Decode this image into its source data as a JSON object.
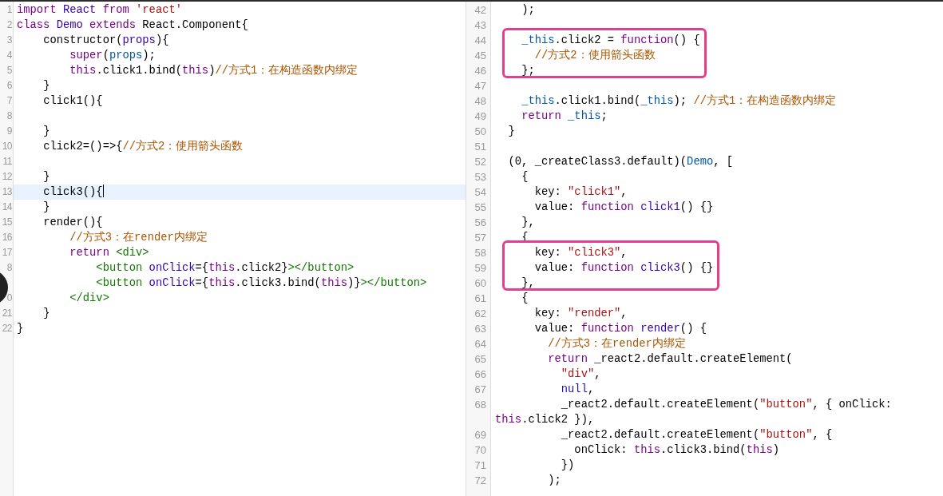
{
  "left_pane": {
    "lines": [
      {
        "number": "1",
        "active": false,
        "tokens": [
          {
            "kind": "keyword",
            "text": "import "
          },
          {
            "kind": "def",
            "text": "React "
          },
          {
            "kind": "keyword",
            "text": "from "
          },
          {
            "kind": "string",
            "text": "'react'"
          }
        ]
      },
      {
        "number": "2",
        "active": false,
        "tokens": [
          {
            "kind": "keyword",
            "text": "class "
          },
          {
            "kind": "def",
            "text": "Demo "
          },
          {
            "kind": "keyword",
            "text": "extends"
          },
          {
            "kind": "plain",
            "text": " React.Component{"
          }
        ]
      },
      {
        "number": "3",
        "active": false,
        "tokens": [
          {
            "kind": "plain",
            "text": "    constructor("
          },
          {
            "kind": "def",
            "text": "props"
          },
          {
            "kind": "plain",
            "text": "){"
          }
        ]
      },
      {
        "number": "4",
        "active": false,
        "tokens": [
          {
            "kind": "keyword",
            "text": "        super"
          },
          {
            "kind": "plain",
            "text": "("
          },
          {
            "kind": "var",
            "text": "props"
          },
          {
            "kind": "plain",
            "text": ");"
          }
        ]
      },
      {
        "number": "5",
        "active": false,
        "tokens": [
          {
            "kind": "keyword",
            "text": "        this"
          },
          {
            "kind": "plain",
            "text": ".click1.bind("
          },
          {
            "kind": "keyword",
            "text": "this"
          },
          {
            "kind": "plain",
            "text": ")"
          },
          {
            "kind": "comment",
            "text": "//方式1：在构造函数内绑定"
          }
        ]
      },
      {
        "number": "6",
        "active": false,
        "tokens": [
          {
            "kind": "plain",
            "text": "    }"
          }
        ]
      },
      {
        "number": "7",
        "active": false,
        "tokens": [
          {
            "kind": "plain",
            "text": "    click1(){"
          }
        ]
      },
      {
        "number": "8",
        "active": false
      },
      {
        "number": "9",
        "active": false,
        "tokens": [
          {
            "kind": "plain",
            "text": "    }"
          }
        ]
      },
      {
        "number": "10",
        "active": false,
        "tokens": [
          {
            "kind": "plain",
            "text": "    click2=()=>{"
          },
          {
            "kind": "comment",
            "text": "//方式2：使用箭头函数"
          }
        ]
      },
      {
        "number": "11",
        "active": false
      },
      {
        "number": "12",
        "active": false,
        "tokens": [
          {
            "kind": "plain",
            "text": "    }"
          }
        ]
      },
      {
        "number": "13",
        "active": true,
        "tokens": [
          {
            "kind": "plain",
            "text": "    click3(){"
          }
        ]
      },
      {
        "number": "14",
        "active": false,
        "tokens": [
          {
            "kind": "plain",
            "text": "    }"
          }
        ]
      },
      {
        "number": "15",
        "active": false,
        "tokens": [
          {
            "kind": "plain",
            "text": "    render(){"
          }
        ]
      },
      {
        "number": "16",
        "active": false,
        "tokens": [
          {
            "kind": "comment",
            "text": "        //方式3：在render内绑定"
          }
        ]
      },
      {
        "number": "17",
        "active": false,
        "tokens": [
          {
            "kind": "keyword",
            "text": "        return "
          },
          {
            "kind": "tag",
            "text": "<div>"
          }
        ]
      },
      {
        "number": "8",
        "active": false,
        "tokens": [
          {
            "kind": "tag",
            "text": "            <button "
          },
          {
            "kind": "attr",
            "text": "onClick"
          },
          {
            "kind": "plain",
            "text": "={"
          },
          {
            "kind": "keyword",
            "text": "this"
          },
          {
            "kind": "plain",
            "text": ".click2}"
          },
          {
            "kind": "tag",
            "text": "></button>"
          }
        ]
      },
      {
        "active": false,
        "tokens": [
          {
            "kind": "tag",
            "text": "            <button "
          },
          {
            "kind": "attr",
            "text": "onClick"
          },
          {
            "kind": "plain",
            "text": "={"
          },
          {
            "kind": "keyword",
            "text": "this"
          },
          {
            "kind": "plain",
            "text": ".click3.bind("
          },
          {
            "kind": "keyword",
            "text": "this"
          },
          {
            "kind": "plain",
            "text": ")}"
          },
          {
            "kind": "tag",
            "text": "></button>"
          }
        ]
      },
      {
        "number": "0",
        "active": false,
        "tokens": [
          {
            "kind": "tag",
            "text": "        </div>"
          }
        ]
      },
      {
        "number": "21",
        "active": false,
        "tokens": [
          {
            "kind": "plain",
            "text": "    }"
          }
        ]
      },
      {
        "number": "22",
        "active": false,
        "tokens": [
          {
            "kind": "plain",
            "text": "}"
          }
        ]
      }
    ]
  },
  "right_pane": {
    "lines": [
      {
        "number": "42",
        "boxed": false,
        "tokens": [
          {
            "kind": "plain",
            "text": "    );"
          }
        ]
      },
      {
        "number": "43",
        "boxed": false
      },
      {
        "number": "44",
        "boxed": true,
        "tokens": [
          {
            "kind": "var",
            "text": "    _this"
          },
          {
            "kind": "plain",
            "text": ".click2 = "
          },
          {
            "kind": "keyword",
            "text": "function"
          },
          {
            "kind": "plain",
            "text": "() {"
          }
        ]
      },
      {
        "number": "45",
        "boxed": true,
        "tokens": [
          {
            "kind": "comment",
            "text": "      //方式2：使用箭头函数"
          }
        ]
      },
      {
        "number": "46",
        "boxed": true,
        "tokens": [
          {
            "kind": "plain",
            "text": "    };"
          }
        ]
      },
      {
        "number": "47",
        "boxed": false
      },
      {
        "number": "48",
        "boxed": false,
        "tokens": [
          {
            "kind": "var",
            "text": "    _this"
          },
          {
            "kind": "plain",
            "text": ".click1.bind("
          },
          {
            "kind": "var",
            "text": "_this"
          },
          {
            "kind": "plain",
            "text": "); "
          },
          {
            "kind": "comment",
            "text": "//方式1：在构造函数内绑定"
          }
        ]
      },
      {
        "number": "49",
        "boxed": false,
        "tokens": [
          {
            "kind": "keyword",
            "text": "    return "
          },
          {
            "kind": "var",
            "text": "_this"
          },
          {
            "kind": "plain",
            "text": ";"
          }
        ]
      },
      {
        "number": "50",
        "boxed": false,
        "tokens": [
          {
            "kind": "plain",
            "text": "  }"
          }
        ]
      },
      {
        "number": "51",
        "boxed": false
      },
      {
        "number": "52",
        "boxed": false,
        "tokens": [
          {
            "kind": "plain",
            "text": "  (0, _createClass3.default)("
          },
          {
            "kind": "var",
            "text": "Demo"
          },
          {
            "kind": "plain",
            "text": ", ["
          }
        ]
      },
      {
        "number": "53",
        "boxed": false,
        "tokens": [
          {
            "kind": "plain",
            "text": "    {"
          }
        ]
      },
      {
        "number": "54",
        "boxed": false,
        "tokens": [
          {
            "kind": "plain",
            "text": "      key: "
          },
          {
            "kind": "string",
            "text": "\"click1\""
          },
          {
            "kind": "plain",
            "text": ","
          }
        ]
      },
      {
        "number": "55",
        "boxed": false,
        "tokens": [
          {
            "kind": "plain",
            "text": "      value: "
          },
          {
            "kind": "keyword",
            "text": "function "
          },
          {
            "kind": "def",
            "text": "click1"
          },
          {
            "kind": "plain",
            "text": "() {}"
          }
        ]
      },
      {
        "number": "56",
        "boxed": false,
        "tokens": [
          {
            "kind": "plain",
            "text": "    },"
          }
        ]
      },
      {
        "number": "57",
        "boxed": false,
        "tokens": [
          {
            "kind": "plain",
            "text": "    {"
          }
        ]
      },
      {
        "number": "58",
        "boxed": true,
        "tokens": [
          {
            "kind": "plain",
            "text": "      key: "
          },
          {
            "kind": "string",
            "text": "\"click3\""
          },
          {
            "kind": "plain",
            "text": ","
          }
        ]
      },
      {
        "number": "59",
        "boxed": true,
        "tokens": [
          {
            "kind": "plain",
            "text": "      value: "
          },
          {
            "kind": "keyword",
            "text": "function "
          },
          {
            "kind": "def",
            "text": "click3"
          },
          {
            "kind": "plain",
            "text": "() {}"
          }
        ]
      },
      {
        "number": "60",
        "boxed": true,
        "tokens": [
          {
            "kind": "plain",
            "text": "    },"
          }
        ]
      },
      {
        "number": "61",
        "boxed": false,
        "tokens": [
          {
            "kind": "plain",
            "text": "    {"
          }
        ]
      },
      {
        "number": "62",
        "boxed": false,
        "tokens": [
          {
            "kind": "plain",
            "text": "      key: "
          },
          {
            "kind": "string",
            "text": "\"render\""
          },
          {
            "kind": "plain",
            "text": ","
          }
        ]
      },
      {
        "number": "63",
        "boxed": false,
        "tokens": [
          {
            "kind": "plain",
            "text": "      value: "
          },
          {
            "kind": "keyword",
            "text": "function "
          },
          {
            "kind": "def",
            "text": "render"
          },
          {
            "kind": "plain",
            "text": "() {"
          }
        ]
      },
      {
        "number": "64",
        "boxed": false,
        "tokens": [
          {
            "kind": "comment",
            "text": "        //方式3：在render内绑定"
          }
        ]
      },
      {
        "number": "65",
        "boxed": false,
        "tokens": [
          {
            "kind": "keyword",
            "text": "        return"
          },
          {
            "kind": "plain",
            "text": " _react2.default.createElement("
          }
        ]
      },
      {
        "number": "66",
        "boxed": false,
        "tokens": [
          {
            "kind": "string",
            "text": "          \"div\""
          },
          {
            "kind": "plain",
            "text": ","
          }
        ]
      },
      {
        "number": "67",
        "boxed": false,
        "tokens": [
          {
            "kind": "atom",
            "text": "          null"
          },
          {
            "kind": "plain",
            "text": ","
          }
        ]
      },
      {
        "number": "68",
        "boxed": false,
        "tokens": [
          {
            "kind": "plain",
            "text": "          _react2.default.createElement("
          },
          {
            "kind": "string",
            "text": "\"button\""
          },
          {
            "kind": "plain",
            "text": ", { onClick: "
          },
          {
            "kind": "keyword",
            "text": "this"
          },
          {
            "kind": "plain",
            "text": ".click2 }),"
          }
        ]
      },
      {
        "number": "69",
        "boxed": false,
        "tokens": [
          {
            "kind": "plain",
            "text": "          _react2.default.createElement("
          },
          {
            "kind": "string",
            "text": "\"button\""
          },
          {
            "kind": "plain",
            "text": ", {"
          }
        ]
      },
      {
        "number": "70",
        "boxed": false,
        "tokens": [
          {
            "kind": "plain",
            "text": "            onClick: "
          },
          {
            "kind": "keyword",
            "text": "this"
          },
          {
            "kind": "plain",
            "text": ".click3.bind("
          },
          {
            "kind": "keyword",
            "text": "this"
          },
          {
            "kind": "plain",
            "text": ")"
          }
        ]
      },
      {
        "number": "71",
        "boxed": false,
        "tokens": [
          {
            "kind": "plain",
            "text": "          })"
          }
        ]
      },
      {
        "number": "72",
        "boxed": false,
        "tokens": [
          {
            "kind": "plain",
            "text": "        );"
          }
        ]
      }
    ]
  }
}
